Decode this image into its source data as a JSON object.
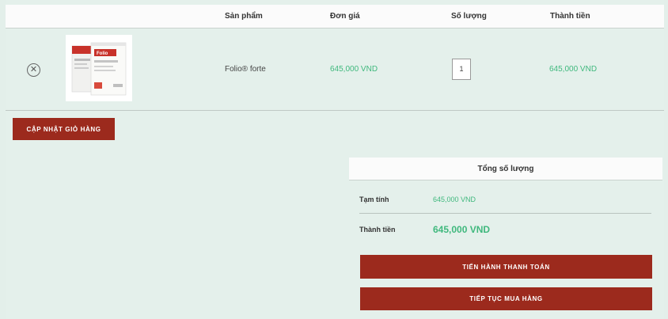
{
  "table": {
    "headers": {
      "product": "Sản phẩm",
      "price": "Đơn giá",
      "qty": "Số lượng",
      "total": "Thành tiền"
    },
    "items": [
      {
        "name": "Folio® forte",
        "price": "645,000 VND",
        "qty": "1",
        "total": "645,000 VND",
        "remove_icon": "close-circle-icon",
        "thumbnail": "Folio"
      }
    ]
  },
  "actions": {
    "update_cart": "CẬP NHẬT GIỎ HÀNG"
  },
  "totals": {
    "title": "Tổng số lượng",
    "subtotal_label": "Tạm tính",
    "subtotal_value": "645,000 VND",
    "total_label": "Thành tiền",
    "total_value": "645,000 VND",
    "checkout_button": "TIẾN HÀNH THANH TOÁN",
    "continue_button": "TIẾP TỤC MUA HÀNG"
  },
  "colors": {
    "accent": "#9c2a1d",
    "price_green": "#3fb87d",
    "background": "#e4f0eb"
  }
}
